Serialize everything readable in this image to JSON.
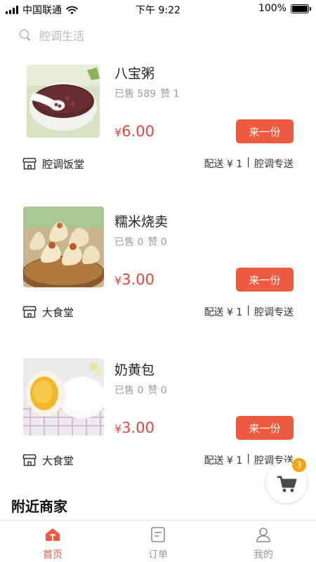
{
  "status_bar": {
    "carrier": "中国联通",
    "time": "下午 9:22",
    "battery": "100%"
  },
  "search": {
    "placeholder": "腔调生活"
  },
  "items": [
    {
      "title": "八宝粥",
      "sold": "已售 589",
      "likes": "赞 1",
      "currency": "¥",
      "price": "6.00",
      "button": "来一份",
      "shop": "腔调饭堂",
      "delivery_fee": "配送 ¥ 1",
      "divider": "|",
      "delivery_method": "腔调专送"
    },
    {
      "title": "糯米烧卖",
      "sold": "已售 0",
      "likes": "赞 0",
      "currency": "¥",
      "price": "3.00",
      "button": "来一份",
      "shop": "大食堂",
      "delivery_fee": "配送 ¥ 1",
      "divider": "|",
      "delivery_method": "腔调专送"
    },
    {
      "title": "奶黄包",
      "sold": "已售 0",
      "likes": "赞 0",
      "currency": "¥",
      "price": "3.00",
      "button": "来一份",
      "shop": "大食堂",
      "delivery_fee": "配送 ¥ 1",
      "divider": "|",
      "delivery_method": "腔调专送"
    }
  ],
  "cart": {
    "count": "3",
    "icon": "cart-icon"
  },
  "section": {
    "title": "附近商家"
  },
  "tabbar": {
    "tabs": [
      {
        "label": "首页",
        "icon": "home-icon",
        "active": true
      },
      {
        "label": "订单",
        "icon": "order-icon",
        "active": false
      },
      {
        "label": "我的",
        "icon": "profile-icon",
        "active": false
      }
    ]
  },
  "colors": {
    "accent": "#ee5a3f",
    "price": "#e2463a",
    "badge": "#f3a316",
    "muted": "#9b9b9b"
  }
}
